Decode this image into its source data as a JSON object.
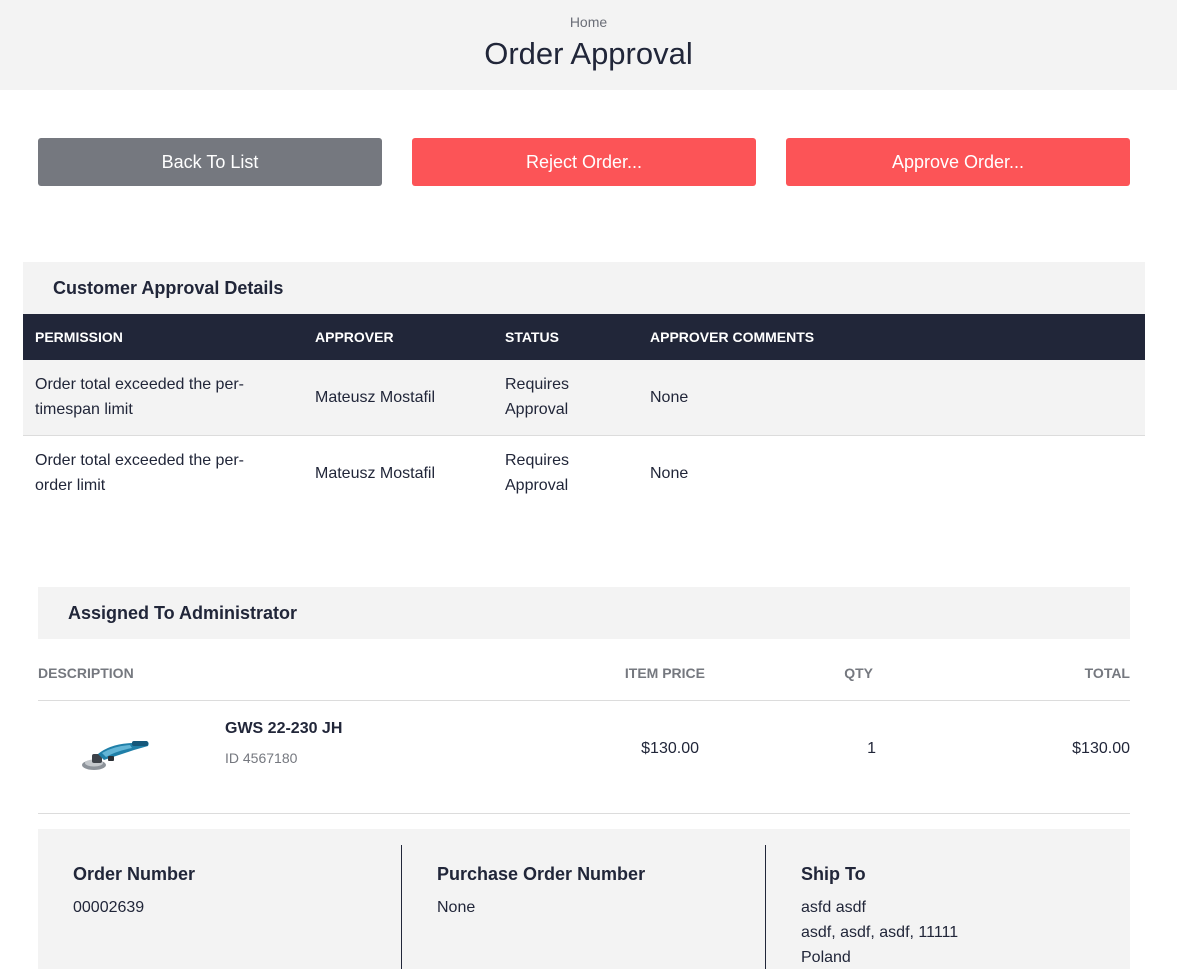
{
  "header": {
    "breadcrumb": "Home",
    "title": "Order Approval"
  },
  "actions": {
    "back_label": "Back To List",
    "reject_label": "Reject Order...",
    "approve_label": "Approve Order..."
  },
  "approval": {
    "title": "Customer Approval Details",
    "columns": [
      "PERMISSION",
      "APPROVER",
      "STATUS",
      "APPROVER COMMENTS"
    ],
    "rows": [
      {
        "permission_line1": "Order total exceeded the per-",
        "permission_line2": "timespan limit",
        "approver": "Mateusz Mostafil",
        "status_line1": "Requires",
        "status_line2": "Approval",
        "comments": "None"
      },
      {
        "permission_line1": "Order total exceeded the per-",
        "permission_line2": "order limit",
        "approver": "Mateusz Mostafil",
        "status_line1": "Requires",
        "status_line2": "Approval",
        "comments": "None"
      }
    ]
  },
  "assigned": {
    "title": "Assigned To Administrator"
  },
  "line_items": {
    "columns": {
      "description": "DESCRIPTION",
      "item_price": "ITEM PRICE",
      "qty": "QTY",
      "total": "TOTAL"
    },
    "items": [
      {
        "name": "GWS 22-230 JH",
        "id_text": "ID 4567180",
        "price": "$130.00",
        "qty": "1",
        "total": "$130.00",
        "image_icon": "angle-grinder-product-image"
      }
    ]
  },
  "summary": {
    "order_number_label": "Order Number",
    "order_number": "00002639",
    "po_label": "Purchase Order Number",
    "po_value": "None",
    "ship_to_label": "Ship To",
    "ship_line1": "asfd asdf",
    "ship_line2": "asdf, asdf, asdf, 11111",
    "ship_line3": "Poland"
  },
  "colors": {
    "accent": "#fc5457",
    "dark": "#212639",
    "gray_button": "#75787f",
    "panel": "#f3f3f3"
  }
}
